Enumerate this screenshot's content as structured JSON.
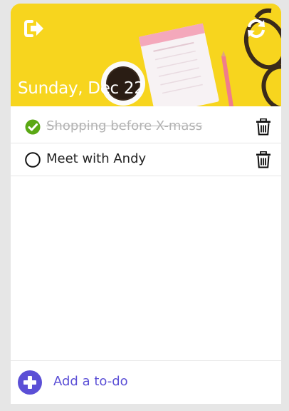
{
  "header": {
    "date": "Sunday, Dec 22",
    "background_color": "#f7d51e",
    "logout_icon": "sign-out-icon",
    "refresh_icon": "refresh-icon"
  },
  "todos": [
    {
      "text": "Shopping before X-mass",
      "done": true,
      "check_icon": "check-circle-icon",
      "delete_icon": "trash-icon"
    },
    {
      "text": "Meet with Andy",
      "done": false,
      "check_icon": "empty-circle-icon",
      "delete_icon": "trash-icon"
    }
  ],
  "footer": {
    "add_label": "Add a to-do",
    "add_icon": "plus-circle-icon",
    "accent_color": "#5b4fd6"
  },
  "colors": {
    "done_check": "#5aa814",
    "done_text": "#b3b3b3"
  }
}
